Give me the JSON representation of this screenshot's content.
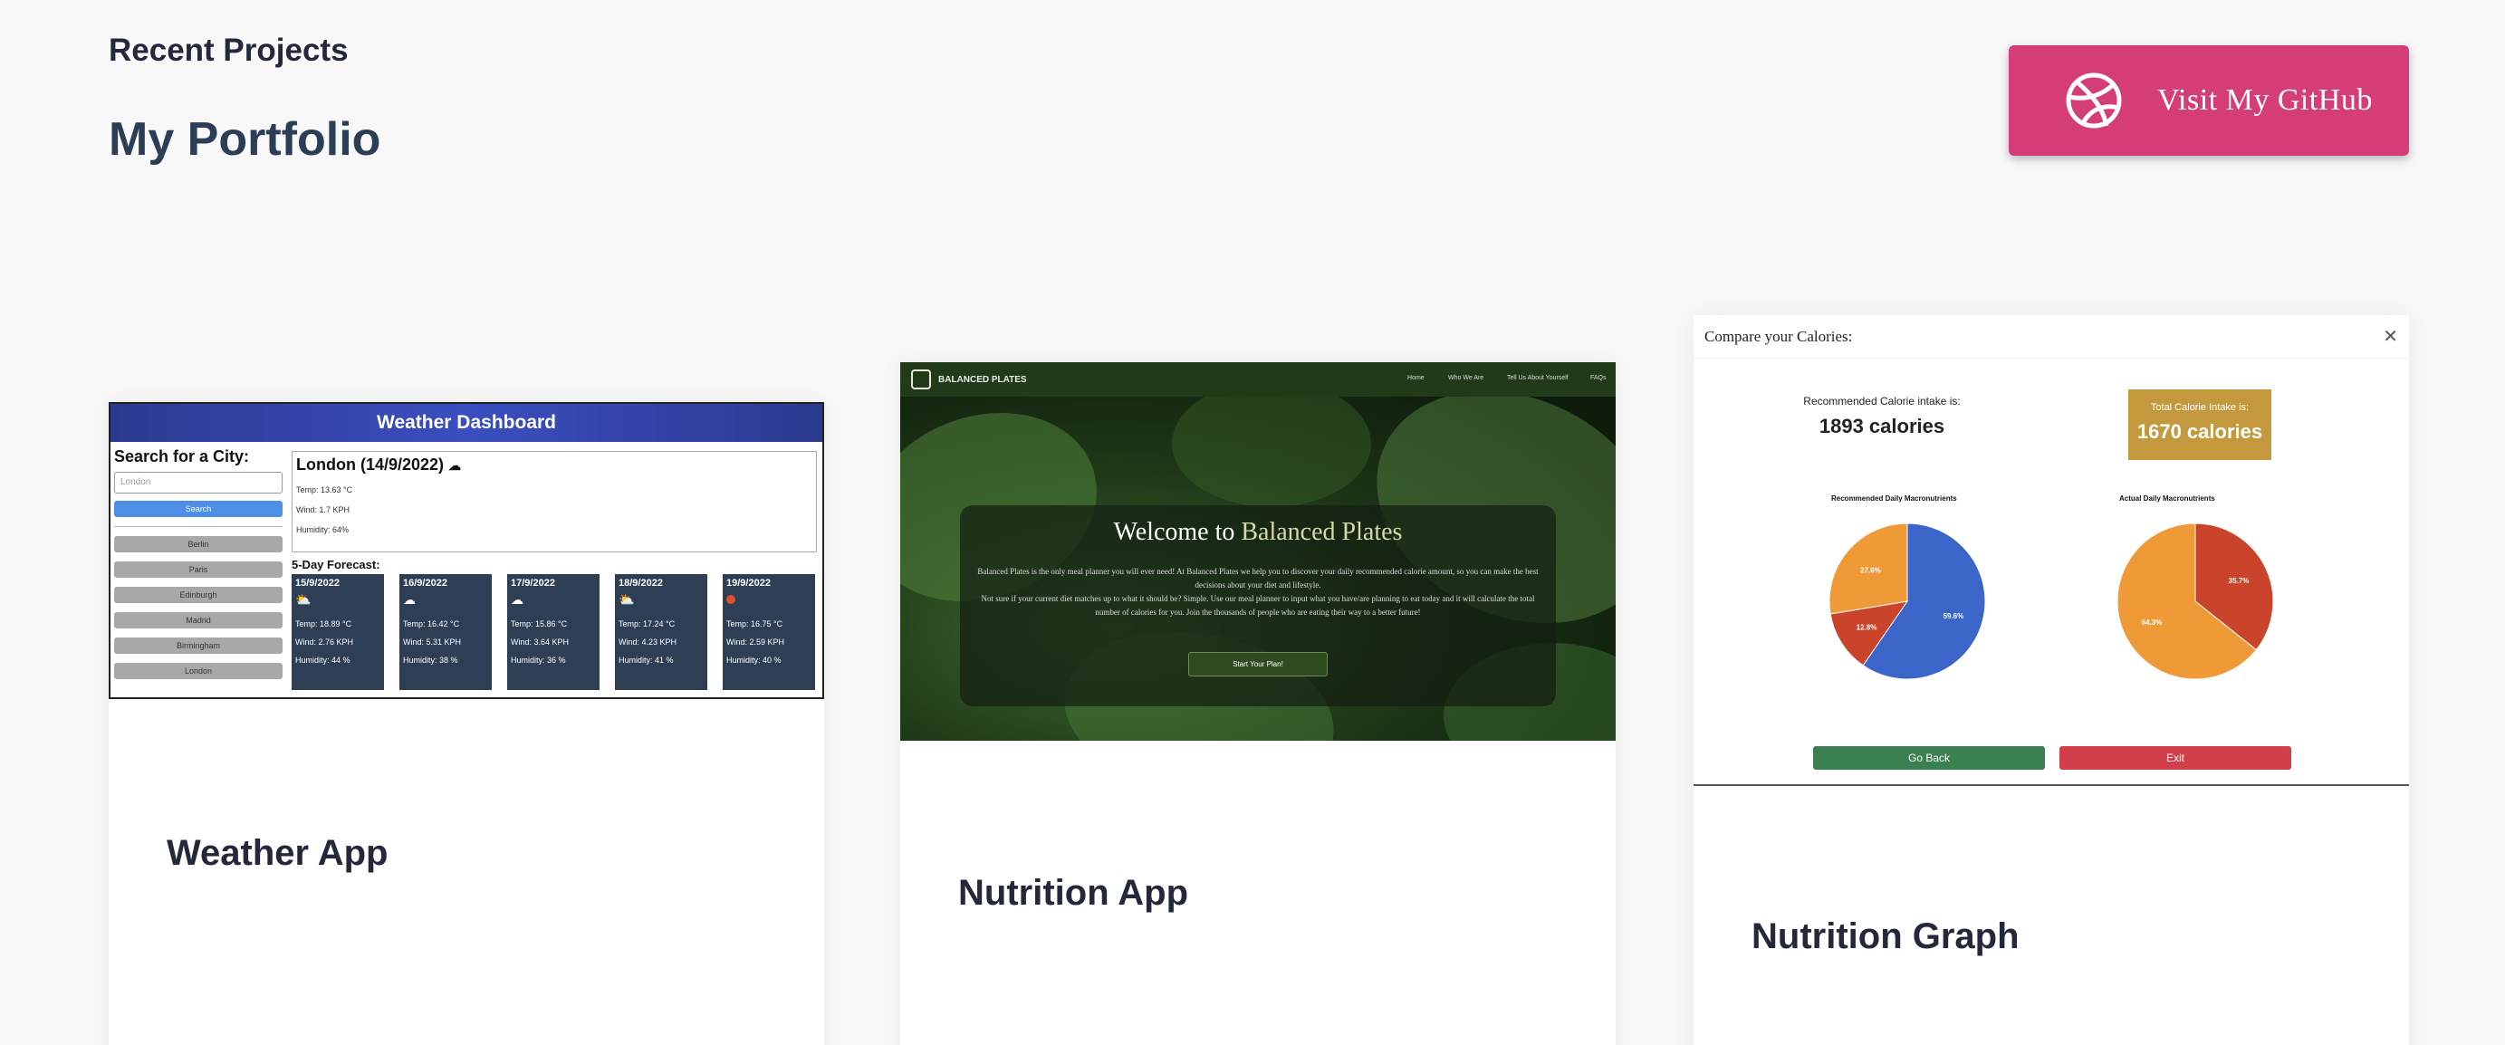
{
  "header": {
    "recent": "Recent Projects",
    "title": "My Portfolio",
    "github_label": "Visit My GitHub"
  },
  "projects": [
    {
      "name": "Weather App"
    },
    {
      "name": "Nutrition App"
    },
    {
      "name": "Nutrition Graph"
    }
  ],
  "weather": {
    "title": "Weather Dashboard",
    "search_title": "Search for a City:",
    "search_placeholder": "London",
    "search_button": "Search",
    "cities": [
      "Berlin",
      "Paris",
      "Edinburgh",
      "Madrid",
      "Birmingham",
      "London"
    ],
    "current": {
      "heading": "London (14/9/2022)",
      "temp": "Temp: 13.63 °C",
      "wind": "Wind: 1.7 KPH",
      "humidity": "Humidity: 64%"
    },
    "forecast_title": "5-Day Forecast:",
    "forecast": [
      {
        "date": "15/9/2022",
        "icon": "cloud-sun-icon",
        "temp": "Temp: 18.89 °C",
        "wind": "Wind: 2.76 KPH",
        "humidity": "Humidity: 44 %"
      },
      {
        "date": "16/9/2022",
        "icon": "cloud-icon",
        "temp": "Temp: 16.42 °C",
        "wind": "Wind: 5.31 KPH",
        "humidity": "Humidity: 38 %"
      },
      {
        "date": "17/9/2022",
        "icon": "cloud-icon",
        "temp": "Temp: 15.86 °C",
        "wind": "Wind: 3.64 KPH",
        "humidity": "Humidity: 36 %"
      },
      {
        "date": "18/9/2022",
        "icon": "cloud-sun-icon",
        "temp": "Temp: 17.24 °C",
        "wind": "Wind: 4.23 KPH",
        "humidity": "Humidity: 41 %"
      },
      {
        "date": "19/9/2022",
        "icon": "sun-icon",
        "temp": "Temp: 16.75 °C",
        "wind": "Wind: 2.59 KPH",
        "humidity": "Humidity: 40 %"
      }
    ]
  },
  "nutrition": {
    "brand": "BALANCED PLATES",
    "nav": [
      "Home",
      "Who We Are",
      "Tell Us About Yourself",
      "FAQs"
    ],
    "welcome": "Welcome to ",
    "welcome_accent": "Balanced Plates",
    "para1": "Balanced Plates is the only meal planner you will ever need! At Balanced Plates we help you to discover your daily recommended calorie amount, so you can make the best decisions about your diet and lifestyle.",
    "para2": "Not sure if your current diet matches up to what it should be? Simple. Use our meal planner to input what you have/are planning to eat today and it will calculate the total number of calories for you. Join the thousands of people who are eating their way to a better future!",
    "button": "Start Your Plan!"
  },
  "graph": {
    "modal_title": "Compare your Calories:",
    "rec_label": "Recommended Calorie intake is:",
    "rec_value": "1893 calories",
    "total_label": "Total Calorie Intake is:",
    "total_value": "1670 calories",
    "back_button": "Go Back",
    "exit_button": "Exit",
    "colors": {
      "blue": "#3b65c9",
      "red": "#c9442a",
      "orange": "#ef9a36",
      "green": "#3b8050",
      "exit": "#d1404a"
    }
  },
  "chart_data": [
    {
      "type": "pie",
      "title": "Recommended Daily Macronutrients",
      "slices": [
        {
          "label": "59.6%",
          "value": 59.6,
          "color": "#3b65c9"
        },
        {
          "label": "12.8%",
          "value": 12.8,
          "color": "#c9442a"
        },
        {
          "label": "27.6%",
          "value": 27.6,
          "color": "#ef9a36"
        }
      ]
    },
    {
      "type": "pie",
      "title": "Actual Daily Macronutrients",
      "slices": [
        {
          "label": "35.7%",
          "value": 35.7,
          "color": "#c9442a"
        },
        {
          "label": "64.3%",
          "value": 64.3,
          "color": "#ef9a36"
        }
      ]
    }
  ]
}
